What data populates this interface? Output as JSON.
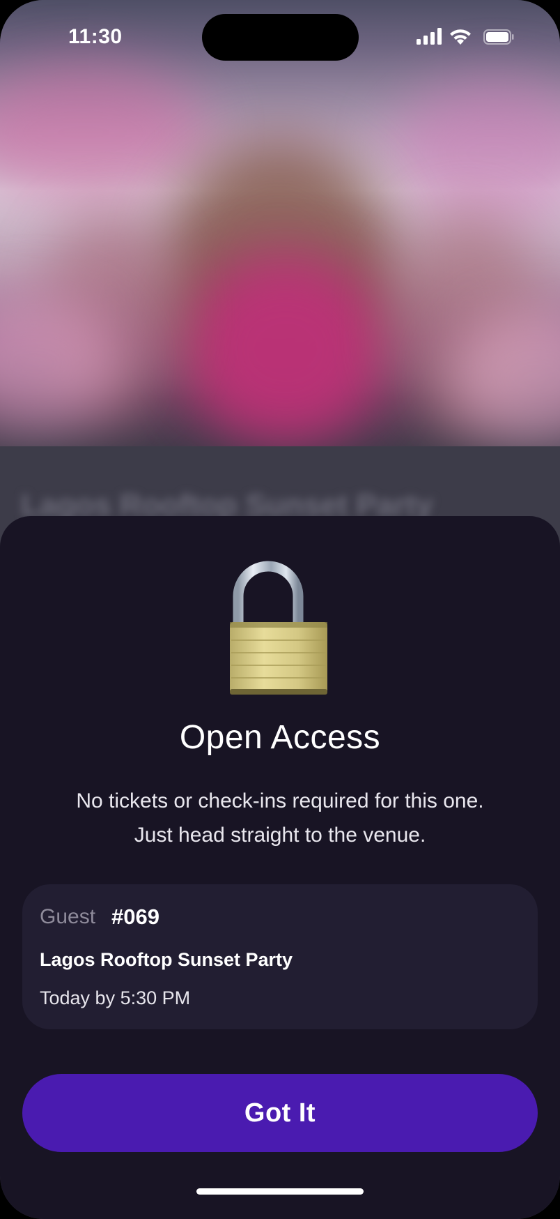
{
  "status_bar": {
    "time": "11:30"
  },
  "background": {
    "blurred_event_title": "Lagos Rooftop Sunset Party"
  },
  "sheet": {
    "icon": "unlocked-padlock-icon",
    "title": "Open Access",
    "description": "No tickets or check-ins required for this one. Just head straight to the venue.",
    "card": {
      "guest_label": "Guest",
      "guest_number": "#069",
      "event_name": "Lagos Rooftop Sunset Party",
      "event_time": "Today by 5:30 PM"
    },
    "button_label": "Got It"
  },
  "colors": {
    "sheet_bg": "#181424",
    "card_bg": "#221e32",
    "button_bg": "#4a1bb0"
  }
}
